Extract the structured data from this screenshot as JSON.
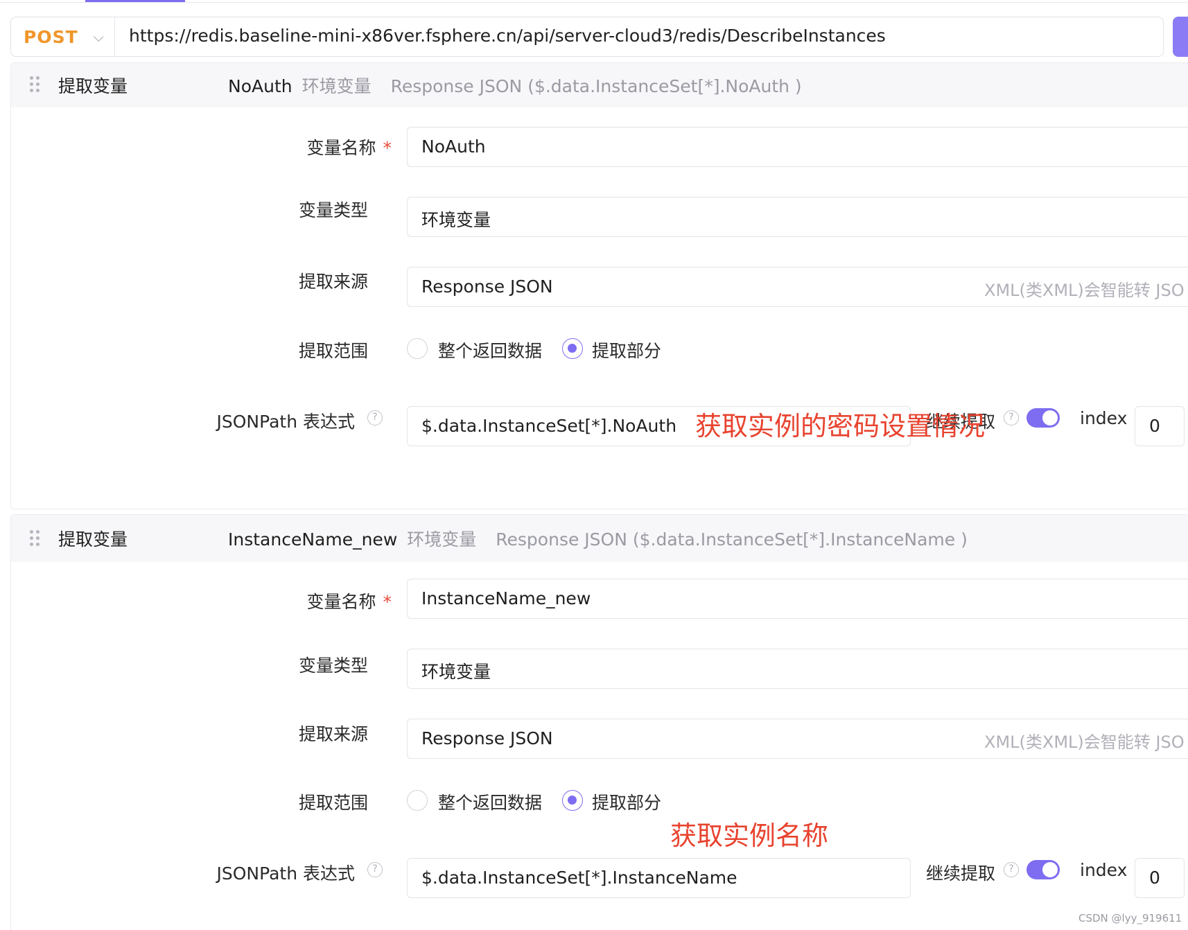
{
  "request": {
    "method": "POST",
    "url": "https://redis.baseline-mini-x86ver.fsphere.cn/api/server-cloud3/redis/DescribeInstances"
  },
  "extractors": [
    {
      "header": {
        "title": "提取变量",
        "name": "NoAuth",
        "type": "环境变量",
        "source": "Response JSON ($.data.InstanceSet[*].NoAuth )"
      },
      "labels": {
        "var_name": "变量名称",
        "required_mark": "*",
        "var_type": "变量类型",
        "source": "提取来源",
        "scope": "提取范围",
        "jsonpath": "JSONPath 表达式",
        "continue": "继续提取",
        "index": "index"
      },
      "var_name_value": "NoAuth",
      "var_type_value": "环境变量",
      "source_value": "Response JSON",
      "source_hint": "XML(类XML)会智能转 JSO",
      "scope_options": [
        "整个返回数据",
        "提取部分"
      ],
      "scope_selected": "提取部分",
      "jsonpath_value": "$.data.InstanceSet[*].NoAuth",
      "continue_enabled": true,
      "index_value": "0",
      "annotation": "获取实例的密码设置情况"
    },
    {
      "header": {
        "title": "提取变量",
        "name": "InstanceName_new",
        "type": "环境变量",
        "source": "Response JSON ($.data.InstanceSet[*].InstanceName )"
      },
      "labels": {
        "var_name": "变量名称",
        "required_mark": "*",
        "var_type": "变量类型",
        "source": "提取来源",
        "scope": "提取范围",
        "jsonpath": "JSONPath 表达式",
        "continue": "继续提取",
        "index": "index"
      },
      "var_name_value": "InstanceName_new",
      "var_type_value": "环境变量",
      "source_value": "Response JSON",
      "source_hint": "XML(类XML)会智能转 JSO",
      "scope_options": [
        "整个返回数据",
        "提取部分"
      ],
      "scope_selected": "提取部分",
      "jsonpath_value": "$.data.InstanceSet[*].InstanceName",
      "continue_enabled": true,
      "index_value": "0",
      "annotation": "获取实例名称"
    }
  ],
  "watermark": "CSDN @lyy_919611",
  "colors": {
    "accent": "#7e6df0",
    "method": "#f0962b",
    "annotation": "#e8432f"
  },
  "icons": {
    "method_dropdown": "chevron-down-icon",
    "drag": "drag-handle-icon",
    "help": "question-circle-icon"
  }
}
